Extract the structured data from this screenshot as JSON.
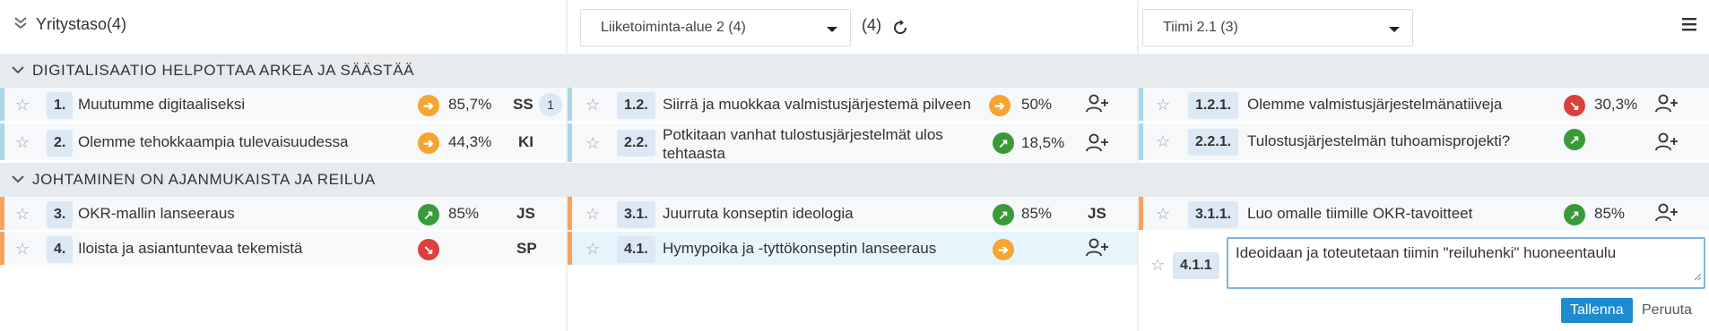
{
  "header": {
    "left_title": "Yritystaso(4)",
    "area_select": "Liiketoiminta-alue 2 (4)",
    "area_count": "(4)",
    "team_select": "Tiimi 2.1 (3)"
  },
  "groups": [
    {
      "title": "DIGITALISAATIO HELPOTTAA ARKEA JA SÄÄSTÄÄ",
      "accent": "#a9d8e8"
    },
    {
      "title": "JOHTAMINEN ON AJANMUKAISTA JA REILUA",
      "accent": "#f7a35c"
    }
  ],
  "company_rows": [
    {
      "num": "1.",
      "label": "Muutumme digitaaliseksi",
      "status": "orange",
      "pct": "85,7%",
      "owner": "SS",
      "badge": "1"
    },
    {
      "num": "2.",
      "label": "Olemme tehokkaampia tulevaisuudessa",
      "status": "orange",
      "pct": "44,3%",
      "owner": "KI"
    },
    {
      "num": "3.",
      "label": "OKR-mallin lanseeraus",
      "status": "green",
      "pct": "85%",
      "owner": "JS"
    },
    {
      "num": "4.",
      "label": "Iloista ja asiantuntevaa tekemistä",
      "status": "red",
      "pct": "",
      "owner": "SP"
    }
  ],
  "area_rows": [
    {
      "num": "1.2.",
      "label": "Siirrä ja muokkaa valmistusjärjestemä pilveen",
      "status": "orange",
      "pct": "50%"
    },
    {
      "num": "2.2.",
      "label": "Potkitaan vanhat tulostusjärjestelmät ulos tehtaasta",
      "status": "green",
      "pct": "18,5%"
    },
    {
      "num": "3.1.",
      "label": "Juurruta konseptin ideologia",
      "status": "green",
      "pct": "85%",
      "owner": "JS"
    },
    {
      "num": "4.1.",
      "label": "Hymypoika ja -tyttökonseptin lanseeraus",
      "status": "orange",
      "pct": ""
    }
  ],
  "team_rows": [
    {
      "num": "1.2.1.",
      "label": "Olemme valmistusjärjestelmänatiiveja",
      "status": "red",
      "pct": "30,3%"
    },
    {
      "num": "2.2.1.",
      "label": "Tulostusjärjestelmän tuhoamisprojekti?",
      "status": "green",
      "pct": ""
    },
    {
      "num": "3.1.1.",
      "label": "Luo omalle tiimille OKR-tavoitteet",
      "status": "green",
      "pct": "85%"
    }
  ],
  "new_item": {
    "num": "4.1.1",
    "text": "Ideoidaan ja toteutetaan tiimin \"reiluhenki\" huoneentaulu",
    "save": "Tallenna",
    "cancel": "Peruuta"
  },
  "icons": {
    "collapse": "chevrons-down-icon",
    "refresh": "refresh-icon",
    "menu": "hamburger-menu-icon",
    "star": "star-outline-icon",
    "add_user": "add-user-icon",
    "status_orange": "arrow-right-icon",
    "status_green": "arrow-up-right-icon",
    "status_red": "arrow-down-right-icon"
  }
}
